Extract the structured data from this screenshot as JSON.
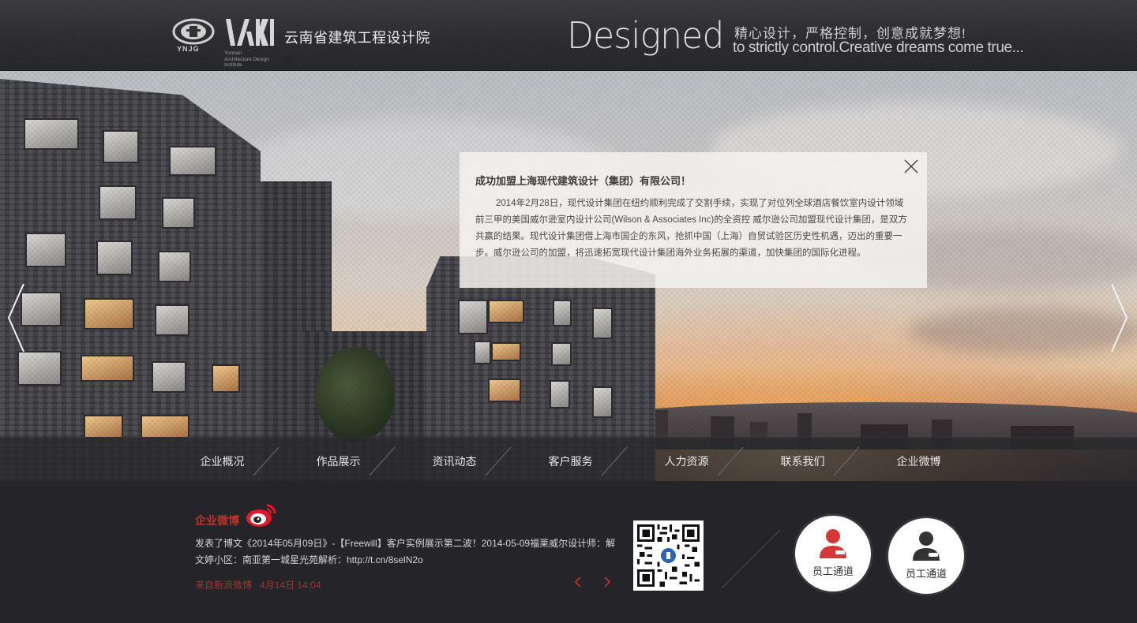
{
  "header": {
    "seal_text": "YNJG",
    "sub_lines": [
      "Yunnan",
      "Architecture Design",
      "Institute"
    ],
    "company_name": "云南省建筑工程设计院",
    "designed": "Designed",
    "slogan_cn": "精心设计，严格控制，创意成就梦想!",
    "slogan_en": "to strictly control.Creative dreams come true..."
  },
  "notice": {
    "title": "成功加盟上海现代建筑设计（集团）有限公司！",
    "body": "2014年2月28日，现代设计集团在纽约顺利完成了交割手续，实现了对位列全球酒店餐饮室内设计领域前三甲的美国威尔逊室内设计公司(Wilson & Associates Inc)的全资控 威尔逊公司加盟现代设计集团，是双方共赢的结果。现代设计集团借上海市国企的东风，抢抓中国（上海）自贸试验区历史性机遇，迈出的重要一步。威尔逊公司的加盟，将迅速拓宽现代设计集团海外业务拓展的渠道，加快集团的国际化进程。"
  },
  "nav": {
    "items": [
      "企业概况",
      "作品展示",
      "资讯动态",
      "客户服务",
      "人力资源",
      "联系我们",
      "企业微博"
    ]
  },
  "weibo": {
    "title": "企业微博",
    "text": "发表了博文《2014年05月09日》-【Freewill】客户实例展示第二波！2014-05-09福莱威尔设计师：解文婷小区：南亚第一城星光苑解析：http://t.cn/8selN2o",
    "source": "来自新浪微博",
    "time": "4月14日 14:04"
  },
  "portals": [
    {
      "label": "员工通道",
      "color": "#d8373a"
    },
    {
      "label": "员工通道",
      "color": "#333333"
    }
  ],
  "colors": {
    "accent": "#c0322d",
    "header_bg": "#2c2c2e",
    "footer_bg": "#252529"
  }
}
